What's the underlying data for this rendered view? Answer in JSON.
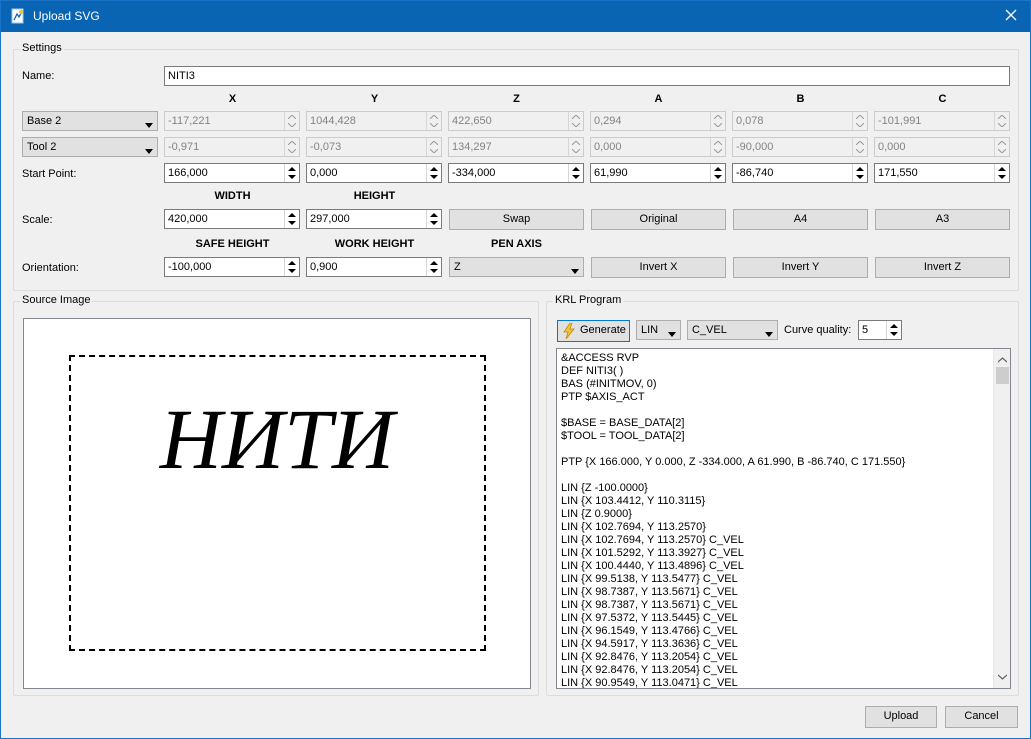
{
  "window": {
    "title": "Upload SVG",
    "close_icon": "close-icon",
    "app_icon": "app-icon"
  },
  "settings": {
    "title": "Settings",
    "name_label": "Name:",
    "name_value": "NITI3",
    "axis_headers": [
      "X",
      "Y",
      "Z",
      "A",
      "B",
      "C"
    ],
    "base": {
      "select": "Base 2",
      "values": [
        "-117,221",
        "1044,428",
        "422,650",
        "0,294",
        "0,078",
        "-101,991"
      ]
    },
    "tool": {
      "select": "Tool 2",
      "values": [
        "-0,971",
        "-0,073",
        "134,297",
        "0,000",
        "-90,000",
        "0,000"
      ]
    },
    "start_point": {
      "label": "Start Point:",
      "values": [
        "166,000",
        "0,000",
        "-334,000",
        "61,990",
        "-86,740",
        "171,550"
      ]
    },
    "width_header": "WIDTH",
    "height_header": "HEIGHT",
    "scale": {
      "label": "Scale:",
      "width": "420,000",
      "height": "297,000"
    },
    "buttons": {
      "swap": "Swap",
      "original": "Original",
      "a4": "A4",
      "a3": "A3"
    },
    "safe_height_header": "SAFE HEIGHT",
    "work_height_header": "WORK HEIGHT",
    "pen_axis_header": "PEN AXIS",
    "orientation": {
      "label": "Orientation:",
      "safe_height": "-100,000",
      "work_height": "0,900",
      "pen_axis": "Z"
    },
    "invert": {
      "x": "Invert X",
      "y": "Invert Y",
      "z": "Invert Z"
    }
  },
  "source": {
    "title": "Source Image",
    "image_text": "НИТИ"
  },
  "krl": {
    "title": "KRL Program",
    "generate_label": "Generate",
    "motion_select": "LIN",
    "vel_select": "C_VEL",
    "curve_quality_label": "Curve quality:",
    "curve_quality_value": "5",
    "lines": [
      "&ACCESS RVP",
      "DEF NITI3( )",
      "BAS (#INITMOV, 0)",
      "PTP $AXIS_ACT",
      "",
      "$BASE = BASE_DATA[2]",
      "$TOOL = TOOL_DATA[2]",
      "",
      "PTP {X 166.000, Y 0.000, Z -334.000, A 61.990, B -86.740, C 171.550}",
      "",
      "LIN {Z -100.0000}",
      "LIN {X 103.4412, Y 110.3115}",
      "LIN {Z 0.9000}",
      "LIN {X 102.7694, Y 113.2570}",
      "LIN {X 102.7694, Y 113.2570} C_VEL",
      "LIN {X 101.5292, Y 113.3927} C_VEL",
      "LIN {X 100.4440, Y 113.4896} C_VEL",
      "LIN {X 99.5138, Y 113.5477} C_VEL",
      "LIN {X 98.7387, Y 113.5671} C_VEL",
      "LIN {X 98.7387, Y 113.5671} C_VEL",
      "LIN {X 97.5372, Y 113.5445} C_VEL",
      "LIN {X 96.1549, Y 113.4766} C_VEL",
      "LIN {X 94.5917, Y 113.3636} C_VEL",
      "LIN {X 92.8476, Y 113.2054} C_VEL",
      "LIN {X 92.8476, Y 113.2054} C_VEL",
      "LIN {X 90.9549, Y 113.0471} C_VEL"
    ]
  },
  "footer": {
    "upload": "Upload",
    "cancel": "Cancel"
  }
}
